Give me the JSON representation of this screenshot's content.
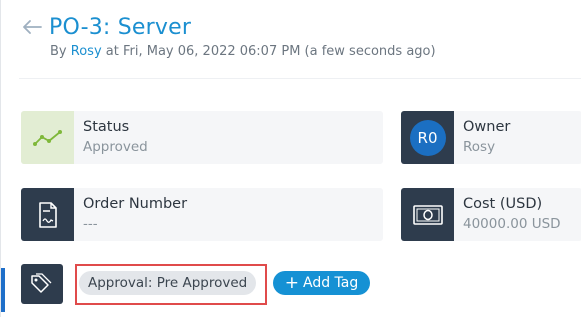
{
  "header": {
    "title": "PO-3: Server",
    "by_prefix": "By",
    "author": "Rosy",
    "timestamp": "at Fri, May 06, 2022 06:07 PM (a few seconds ago)"
  },
  "cards": {
    "status": {
      "label": "Status",
      "value": "Approved",
      "icon": "trend-line-icon"
    },
    "owner": {
      "label": "Owner",
      "value": "Rosy",
      "avatar_initials": "R0"
    },
    "order_number": {
      "label": "Order Number",
      "value": "---",
      "icon": "document-icon"
    },
    "cost": {
      "label": "Cost (USD)",
      "value": "40000.00 USD",
      "icon": "money-icon"
    }
  },
  "tags": {
    "items": [
      "Approval: Pre Approved"
    ],
    "add_label": "Add Tag",
    "icon": "tag-icon"
  },
  "colors": {
    "accent": "#1b8fd0",
    "icon_dark": "#2e3c4d",
    "status_green_bg": "#e2edd3",
    "highlight": "#e04b4b"
  }
}
